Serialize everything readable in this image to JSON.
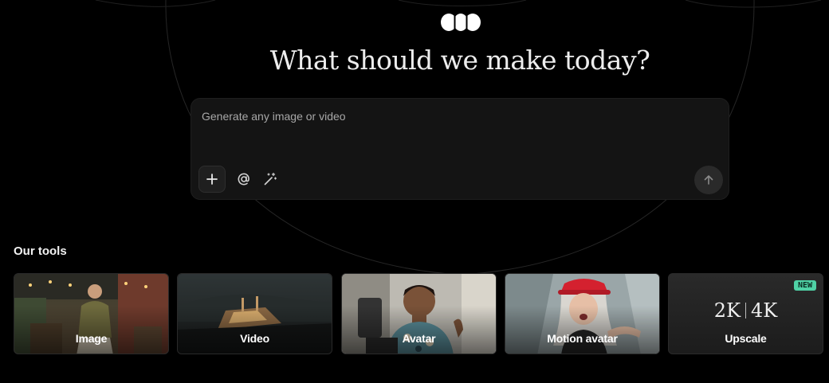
{
  "headline": "What should we make today?",
  "composer": {
    "placeholder": "Generate any image or video",
    "add_icon": "plus-icon",
    "mention_icon": "at-icon",
    "enhance_icon": "magic-wand-icon",
    "send_icon": "arrow-up-icon"
  },
  "tools": {
    "section_title": "Our tools",
    "items": [
      {
        "label": "Image"
      },
      {
        "label": "Video"
      },
      {
        "label": "Avatar"
      },
      {
        "label": "Motion avatar"
      },
      {
        "label": "Upscale",
        "badge": "NEW",
        "res_a": "2K",
        "res_b": "4K"
      }
    ]
  },
  "colors": {
    "background": "#000000",
    "composer_bg": "#141414",
    "badge_new": "#4fd1a5"
  }
}
